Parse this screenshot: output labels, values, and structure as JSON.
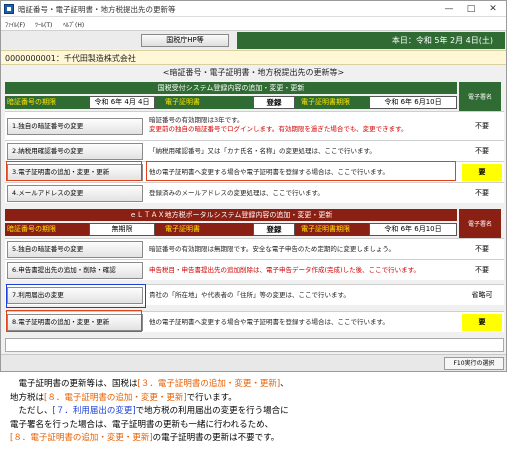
{
  "window": {
    "title": "暗証番号・電子証明書・地方税提出先の更新等",
    "minimize": "—",
    "maximize": "□",
    "close": "✕"
  },
  "menu": [
    "ﾌｧｲﾙ(F)",
    "ﾂｰﾙ(T)",
    "ﾍﾙﾌﾟ(H)"
  ],
  "toolbar": {
    "nta_button": "国税庁HP等",
    "today": "本日：令和 5年 2月 4日(土)"
  },
  "company": "0000000001：千代田製造株式会社",
  "heading": "<暗証番号・電子証明書・地方税提出先の更新等>",
  "sign_header": "電子署名",
  "colors": {
    "green": "#2f6b33",
    "darkred": "#8a1f14",
    "highlight_orange": "#e0431c",
    "highlight_blue": "#1c3fd6",
    "required_yellow": "#ffff00"
  },
  "national": {
    "title": "国税受付システム登録内容の追加・変更・更新",
    "pin_label": "暗証番号の期限",
    "pin_value": "令和 6年 4月 4日",
    "cert_label": "電子証明書",
    "cert_status": "登録",
    "cert_period_label": "電子証明書期限",
    "cert_period_value": "令和 6年 6月10日",
    "rows": [
      {
        "button": "1.独自の暗証番号の変更",
        "desc1": "暗証番号の有効期限は3年です。",
        "desc2": "変更前の独自の暗証番号でログインします。有効期限を過ぎた場合でも、変更できます。",
        "sign": "不要"
      },
      {
        "button": "2.納税用確認番号の変更",
        "desc1": "「納税用確認番号」又は「カナ氏名・名称」の変更処理は、ここで行います。",
        "sign": "不要"
      },
      {
        "button": "3.電子証明書の追加・変更・更新",
        "desc1": "他の電子証明書へ変更する場合や電子証明書を登録する場合は、ここで行います。",
        "sign": "要"
      },
      {
        "button": "4.メールアドレスの変更",
        "desc1": "登録済みのメールアドレスの変更処理は、ここで行います。",
        "sign": "不要"
      }
    ]
  },
  "local": {
    "title": "ｅＬＴＡＸ地方税ポータルシステム登録内容の追加・変更・更新",
    "pin_label": "暗証番号の期限",
    "pin_value": "無期限",
    "cert_label": "電子証明書",
    "cert_status": "登録",
    "cert_period_label": "電子証明書期限",
    "cert_period_value": "令和 6年 6月10日",
    "rows": [
      {
        "button": "5.独自の暗証番号の変更",
        "desc1": "暗証番号の有効期限は無期限です。安全な電子申告のため定期的に変更しましょう。",
        "sign": "不要"
      },
      {
        "button": "6.申告書提出先の追加・削除・確認",
        "desc1": "申告税目・申告書提出先の追加削除は、電子申告データ作成(完成)した後、ここで行います。",
        "sign": "不要"
      },
      {
        "button": "7.利用届出の変更",
        "desc1": "貴社の「所在地」や代表者の「住所」等の変更は、ここで行います。",
        "sign": "省略可"
      },
      {
        "button": "8.電子証明書の追加・変更・更新",
        "desc1": "他の電子証明書へ変更する場合や電子証明書を登録する場合は、ここで行います。",
        "sign": "要"
      }
    ]
  },
  "status": {
    "f10": "F10実行の選択"
  },
  "notes": {
    "l1a": "　電子証明書の更新等は、国税は",
    "l1b": "[３．電子証明書の追加・変更・更新]",
    "l1c": "、",
    "l2a": "地方税は",
    "l2b": "[８．電子証明書の追加・変更・更新]",
    "l2c": "で行います。",
    "l3a": "　ただし、",
    "l3b": "[７．利用届出の変更]",
    "l3c": "で地方税の利用届出の変更を行う場合に",
    "l4": "電子署名を行った場合は、電子証明書の更新も一緒に行われるため、",
    "l5a": "[８．電子証明書の追加・変更・更新]",
    "l5b": "の電子証明書の更新は不要です。"
  }
}
